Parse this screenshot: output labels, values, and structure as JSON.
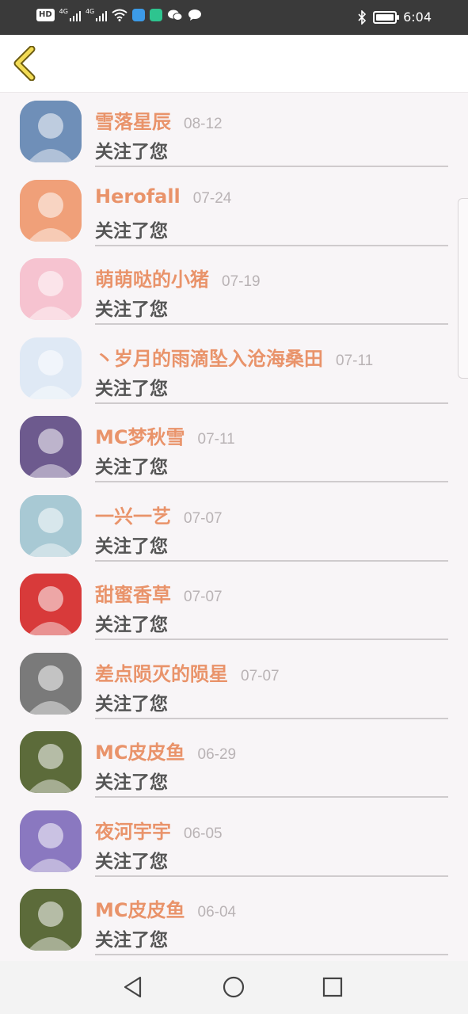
{
  "status_bar": {
    "hd_label": "HD",
    "net1": "4G",
    "net2": "4G",
    "time": "6:04",
    "icons": [
      "hd-icon",
      "signal-icon",
      "signal-icon",
      "wifi-icon",
      "app-icon",
      "app-icon",
      "wechat-icon",
      "chat-bubble-icon",
      "bluetooth-icon",
      "battery-icon"
    ]
  },
  "header": {
    "back_icon": "chevron-left-icon"
  },
  "followers": [
    {
      "name": "雪落星辰",
      "date": "08-12",
      "action": "关注了您",
      "avatar_color": "#6f8fb8"
    },
    {
      "name": "Herofall",
      "date": "07-24",
      "action": "关注了您",
      "avatar_color": "#f0a079"
    },
    {
      "name": "萌萌哒的小猪",
      "date": "07-19",
      "action": "关注了您",
      "avatar_color": "#f6c3d0"
    },
    {
      "name": "丶岁月的雨滴坠入沧海桑田",
      "date": "07-11",
      "action": "关注了您",
      "avatar_color": "#dfe9f5"
    },
    {
      "name": "MC梦秋雪",
      "date": "07-11",
      "action": "关注了您",
      "avatar_color": "#6d5a8e"
    },
    {
      "name": "一兴一艺",
      "date": "07-07",
      "action": "关注了您",
      "avatar_color": "#a8c9d4"
    },
    {
      "name": "甜蜜香草",
      "date": "07-07",
      "action": "关注了您",
      "avatar_color": "#d83a3a"
    },
    {
      "name": "差点陨灭的陨星",
      "date": "07-07",
      "action": "关注了您",
      "avatar_color": "#7a7a7a"
    },
    {
      "name": "MC皮皮鱼",
      "date": "06-29",
      "action": "关注了您",
      "avatar_color": "#5c6b3a"
    },
    {
      "name": "夜河宇宇",
      "date": "06-05",
      "action": "关注了您",
      "avatar_color": "#8a78c0"
    },
    {
      "name": "MC皮皮鱼",
      "date": "06-04",
      "action": "关注了您",
      "avatar_color": "#5c6b3a"
    }
  ],
  "nav_bar": {
    "icons": [
      "back-triangle-icon",
      "home-circle-icon",
      "recents-square-icon"
    ]
  },
  "colors": {
    "name": "#e9936a",
    "date": "#b9b3b5",
    "action": "#555555",
    "background": "#f8f5f7"
  }
}
